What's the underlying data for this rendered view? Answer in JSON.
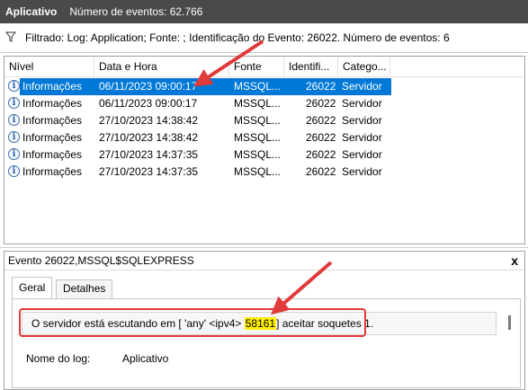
{
  "titlebar": {
    "app": "Aplicativo",
    "count": "Número de eventos: 62.766"
  },
  "filter": {
    "icon": "funnel-icon",
    "text": "Filtrado: Log: Application; Fonte: ; Identificação do Evento: 26022. Número de eventos: 6"
  },
  "grid": {
    "columns": [
      "Nível",
      "Data e Hora",
      "Fonte",
      "Identifi...",
      "Catego..."
    ],
    "rows": [
      {
        "level": "Informações",
        "datetime": "06/11/2023 09:00:17",
        "source": "MSSQL...",
        "id": "26022",
        "category": "Servidor"
      },
      {
        "level": "Informações",
        "datetime": "06/11/2023 09:00:17",
        "source": "MSSQL...",
        "id": "26022",
        "category": "Servidor"
      },
      {
        "level": "Informações",
        "datetime": "27/10/2023 14:38:42",
        "source": "MSSQL...",
        "id": "26022",
        "category": "Servidor"
      },
      {
        "level": "Informações",
        "datetime": "27/10/2023 14:38:42",
        "source": "MSSQL...",
        "id": "26022",
        "category": "Servidor"
      },
      {
        "level": "Informações",
        "datetime": "27/10/2023 14:37:35",
        "source": "MSSQL...",
        "id": "26022",
        "category": "Servidor"
      },
      {
        "level": "Informações",
        "datetime": "27/10/2023 14:37:35",
        "source": "MSSQL...",
        "id": "26022",
        "category": "Servidor"
      }
    ]
  },
  "detail": {
    "title": "Evento 26022,MSSQL$SQLEXPRESS",
    "close": "x",
    "tabs": [
      "Geral",
      "Detalhes"
    ],
    "message_prefix": "O servidor está escutando em [ 'any' <ipv4> ",
    "message_port": "58161",
    "message_suffix": "] aceitar soquetes 1.",
    "log_name_label": "Nome do log:",
    "log_name_value": "Aplicativo"
  },
  "colors": {
    "selection": "#0078d7",
    "annotation": "#e03a3a",
    "highlight": "#ffef00"
  }
}
